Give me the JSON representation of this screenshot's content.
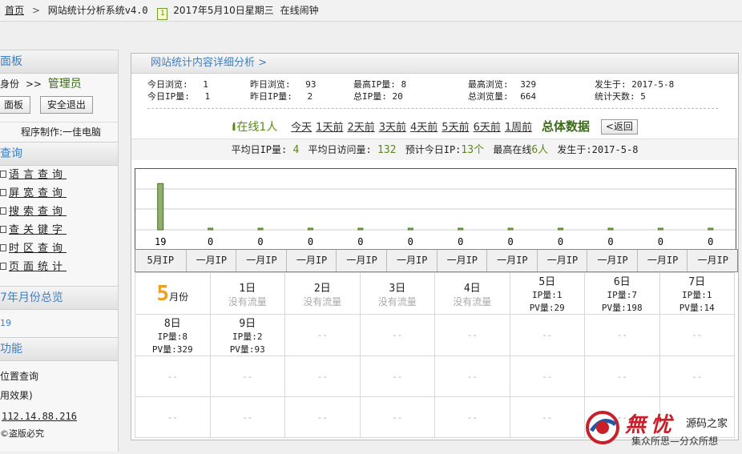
{
  "topbar": {
    "home": "首页",
    "separator": ">",
    "system_title": "网站统计分析系统v4.0",
    "calendar_icon_text": "1",
    "date": "2017年5月10日星期三",
    "alarm": "在线闹钟"
  },
  "sidebar": {
    "panel_head": "面板",
    "identity_label": "身份",
    "identity_sep": ">>",
    "identity_role": "管理员",
    "btn_panel": "面板",
    "btn_logout": "安全退出",
    "author": "程序制作:一佳电脑",
    "query_head": "查询",
    "menu": [
      "语言查询",
      "屏宽查询",
      "搜索查询",
      "查关键字",
      "时区查询",
      "页面统计"
    ],
    "month_head": "7年月份总览",
    "month_value": "19",
    "func_head": "功能",
    "func_items": [
      "位置查询",
      "用效果)"
    ],
    "ip": "112.14.88.216",
    "piracy": "盗版必究"
  },
  "panel": {
    "title": "网站统计内容详细分析 >",
    "stats": {
      "today_pv_label": "今日浏览:",
      "today_pv": "1",
      "yest_pv_label": "昨日浏览:",
      "yest_pv": "93",
      "max_ip_label": "最高IP量:",
      "max_ip": "8",
      "max_pv_label": "最高浏览:",
      "max_pv": "329",
      "occur_label": "发生于:",
      "occur": "2017-5-8",
      "today_ip_label": "今日IP量:",
      "today_ip": "1",
      "yest_ip_label": "昨日IP量:",
      "yest_ip": "2",
      "total_ip_label": "总IP量:",
      "total_ip": "20",
      "total_pv_label": "总浏览量:",
      "total_pv": "664",
      "days_label": "统计天数:",
      "days": "5"
    },
    "nav": {
      "online": "在线1人",
      "days": [
        "今天",
        "1天前",
        "2天前",
        "3天前",
        "4天前",
        "5天前",
        "6天前",
        "1周前"
      ],
      "total": "总体数据",
      "back": "<返回"
    },
    "avg": {
      "avg_ip_label": "平均日IP量:",
      "avg_ip": "4",
      "avg_pv_label": "平均日访问量:",
      "avg_pv": "132",
      "predict_label": "预计今日IP:",
      "predict": "13个",
      "max_online_label": "最高在线",
      "max_online": "6人",
      "occur_label": "发生于:",
      "occur": "2017-5-8"
    }
  },
  "chart_data": {
    "type": "bar",
    "categories": [
      "5月IP",
      "一月IP",
      "一月IP",
      "一月IP",
      "一月IP",
      "一月IP",
      "一月IP",
      "一月IP",
      "一月IP",
      "一月IP",
      "一月IP",
      "一月IP"
    ],
    "values": [
      19,
      0,
      0,
      0,
      0,
      0,
      0,
      0,
      0,
      0,
      0,
      0
    ],
    "ylim": [
      0,
      25
    ],
    "grid": true
  },
  "calendar": {
    "month_num": "5",
    "month_suffix": "月份",
    "days": [
      {
        "day": "1日",
        "status": "没有流量"
      },
      {
        "day": "2日",
        "status": "没有流量"
      },
      {
        "day": "3日",
        "status": "没有流量"
      },
      {
        "day": "4日",
        "status": "没有流量"
      },
      {
        "day": "5日",
        "ip": "IP量:1",
        "pv": "PV量:29"
      },
      {
        "day": "6日",
        "ip": "IP量:7",
        "pv": "PV量:198"
      },
      {
        "day": "7日",
        "ip": "IP量:1",
        "pv": "PV量:14"
      },
      {
        "day": "8日",
        "ip": "IP量:8",
        "pv": "PV量:329"
      },
      {
        "day": "9日",
        "ip": "IP量:2",
        "pv": "PV量:93"
      }
    ],
    "empty": "--"
  },
  "watermark": {
    "logo_text": "無忧",
    "site": "源码之家",
    "slogan": "集众所思—分众所想"
  },
  "colors": {
    "accent": "#3d7fc1",
    "green": "#5a8a1a",
    "bar": "#8fb06a",
    "month": "#f0a020"
  }
}
